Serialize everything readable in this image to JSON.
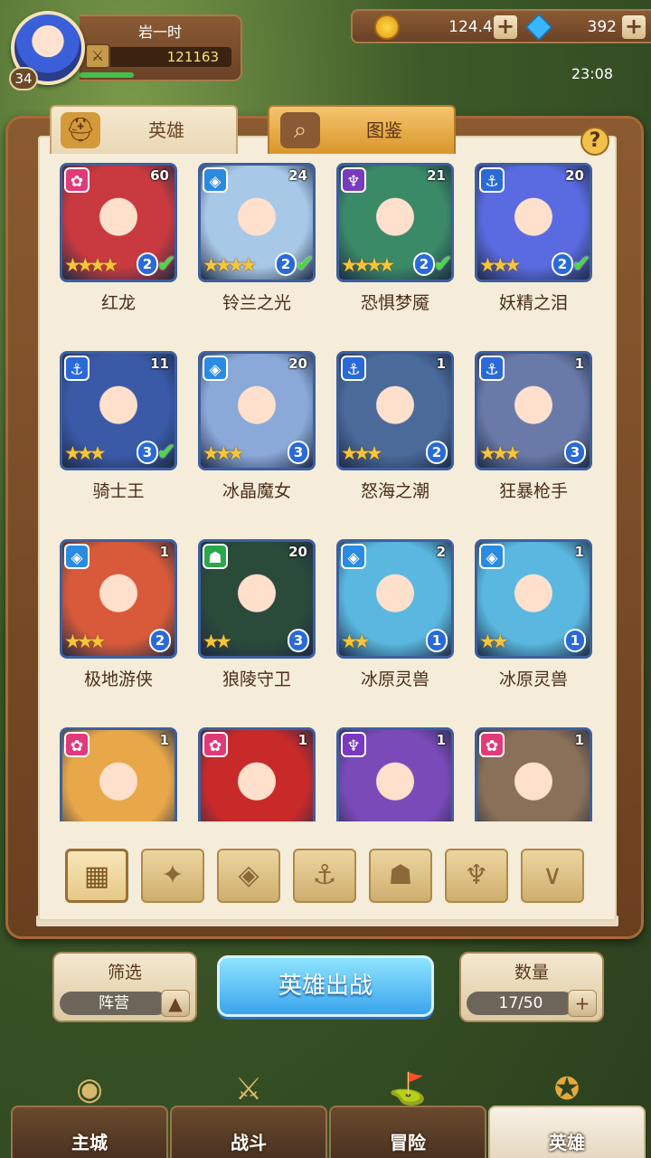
{
  "player": {
    "name": "岩一时",
    "level": "34",
    "power": "121163",
    "hp_fraction": 0.35,
    "time": "23:08"
  },
  "currency": {
    "gold": "124.4K",
    "gems": "392"
  },
  "tabs": [
    {
      "label": "英雄",
      "icon": "helmet-icon"
    },
    {
      "label": "图鉴",
      "icon": "magnifier-icon"
    }
  ],
  "help_label": "?",
  "faction_colors": {
    "fire": "#e23a78",
    "ice": "#2a8be0",
    "dark": "#7a3ac0",
    "sea": "#2a6ad8",
    "beast": "#2aa84a"
  },
  "heroes": [
    {
      "name": "红龙",
      "level": "60",
      "faction": "fire",
      "stars": "★★★★",
      "rank": "2",
      "deployed": true,
      "art": "#c83a40"
    },
    {
      "name": "铃兰之光",
      "level": "24",
      "faction": "ice",
      "stars": "★★★★",
      "rank": "2",
      "deployed": true,
      "art": "#a8c8e8"
    },
    {
      "name": "恐惧梦魇",
      "level": "21",
      "faction": "dark",
      "stars": "★★★★",
      "rank": "2",
      "deployed": true,
      "art": "#3a8a68"
    },
    {
      "name": "妖精之泪",
      "level": "20",
      "faction": "sea",
      "stars": "★★★",
      "rank": "2",
      "deployed": true,
      "art": "#5a6ae0"
    },
    {
      "name": "骑士王",
      "level": "11",
      "faction": "sea",
      "stars": "★★★",
      "rank": "3",
      "deployed": true,
      "art": "#3a5aa8"
    },
    {
      "name": "冰晶魔女",
      "level": "20",
      "faction": "ice",
      "stars": "★★★",
      "rank": "3",
      "deployed": false,
      "art": "#8aa8d8"
    },
    {
      "name": "怒海之潮",
      "level": "1",
      "faction": "sea",
      "stars": "★★★",
      "rank": "2",
      "deployed": false,
      "art": "#4a6a9a"
    },
    {
      "name": "狂暴枪手",
      "level": "1",
      "faction": "sea",
      "stars": "★★★",
      "rank": "3",
      "deployed": false,
      "art": "#6a7aa8"
    },
    {
      "name": "极地游侠",
      "level": "1",
      "faction": "ice",
      "stars": "★★★",
      "rank": "2",
      "deployed": false,
      "art": "#d85a3a"
    },
    {
      "name": "狼陵守卫",
      "level": "20",
      "faction": "beast",
      "stars": "★★",
      "rank": "3",
      "deployed": false,
      "art": "#2a4a3a"
    },
    {
      "name": "冰原灵兽",
      "level": "2",
      "faction": "ice",
      "stars": "★★",
      "rank": "1",
      "deployed": false,
      "art": "#5ab8e0"
    },
    {
      "name": "冰原灵兽",
      "level": "1",
      "faction": "ice",
      "stars": "★★",
      "rank": "1",
      "deployed": false,
      "art": "#5ab8e0"
    },
    {
      "name": "",
      "level": "1",
      "faction": "fire",
      "stars": "",
      "rank": "",
      "deployed": false,
      "art": "#e8a84a"
    },
    {
      "name": "",
      "level": "1",
      "faction": "fire",
      "stars": "",
      "rank": "",
      "deployed": false,
      "art": "#c82a2a"
    },
    {
      "name": "",
      "level": "1",
      "faction": "dark",
      "stars": "",
      "rank": "",
      "deployed": false,
      "art": "#7a4ab8"
    },
    {
      "name": "",
      "level": "1",
      "faction": "fire",
      "stars": "",
      "rank": "",
      "deployed": false,
      "art": "#8a7058"
    }
  ],
  "faction_filters": [
    {
      "name": "filter-all",
      "icon": "grid-icon",
      "glyph": "▦",
      "active": true
    },
    {
      "name": "filter-fire",
      "icon": "flame-icon",
      "glyph": "✦",
      "active": false
    },
    {
      "name": "filter-ice",
      "icon": "diamond-icon",
      "glyph": "◈",
      "active": false
    },
    {
      "name": "filter-sea",
      "icon": "anchor-icon",
      "glyph": "⚓",
      "active": false
    },
    {
      "name": "filter-beast",
      "icon": "beast-head-icon",
      "glyph": "☗",
      "active": false
    },
    {
      "name": "filter-dark",
      "icon": "demon-icon",
      "glyph": "♆",
      "active": false
    },
    {
      "name": "filter-light",
      "icon": "wings-icon",
      "glyph": "∨",
      "active": false
    }
  ],
  "filter_panel": {
    "title": "筛选",
    "value": "阵营",
    "button": "▲"
  },
  "deploy_button": "英雄出战",
  "count_panel": {
    "title": "数量",
    "value": "17/50",
    "button": "+"
  },
  "nav": [
    {
      "label": "主城",
      "icon": "castle-icon",
      "glyph": "◉",
      "active": false
    },
    {
      "label": "战斗",
      "icon": "crossed-swords-icon",
      "glyph": "⚔",
      "active": false
    },
    {
      "label": "冒险",
      "icon": "scroll-map-icon",
      "glyph": "⛳",
      "active": false
    },
    {
      "label": "英雄",
      "icon": "hero-crest-icon",
      "glyph": "✪",
      "active": true
    }
  ]
}
